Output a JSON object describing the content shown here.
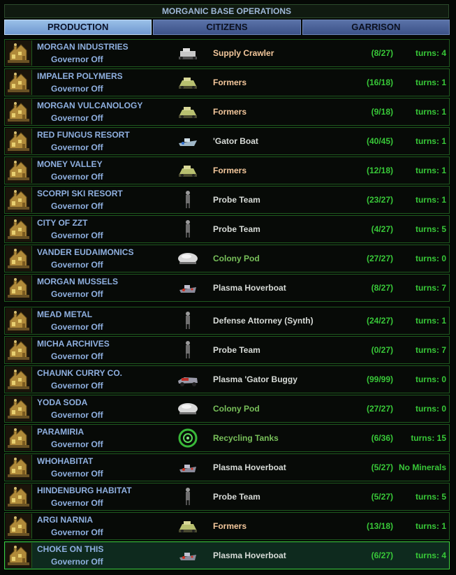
{
  "window_title": "MORGANIC BASE OPERATIONS",
  "tabs": [
    {
      "label": "PRODUCTION",
      "active": true
    },
    {
      "label": "CITIZENS",
      "active": false
    },
    {
      "label": "GARRISON",
      "active": false
    }
  ],
  "colors": {
    "facility": "#f4c89c",
    "unit": "#d8dcd8",
    "special": "#78c05a",
    "progress": "#38c838",
    "base_name": "#8fb0e0",
    "selected_border": "#3ed03e"
  },
  "bases": [
    {
      "name": "MORGAN INDUSTRIES",
      "governor": "Governor Off",
      "icon": "supply-crawler-icon",
      "item": "Supply Crawler",
      "item_color": "peach",
      "progress": "(8/27)",
      "turns": "turns: 4",
      "selected": false
    },
    {
      "name": "IMPALER POLYMERS",
      "governor": "Governor Off",
      "icon": "formers-icon",
      "item": "Formers",
      "item_color": "peach",
      "progress": "(16/18)",
      "turns": "turns: 1",
      "selected": false
    },
    {
      "name": "MORGAN VULCANOLOGY",
      "governor": "Governor Off",
      "icon": "formers-icon",
      "item": "Formers",
      "item_color": "peach",
      "progress": "(9/18)",
      "turns": "turns: 1",
      "selected": false
    },
    {
      "name": "RED FUNGUS RESORT",
      "governor": "Governor Off",
      "icon": "gator-boat-icon",
      "item": "'Gator Boat",
      "item_color": "white",
      "progress": "(40/45)",
      "turns": "turns: 1",
      "selected": false
    },
    {
      "name": "MONEY VALLEY",
      "governor": "Governor Off",
      "icon": "formers-icon",
      "item": "Formers",
      "item_color": "peach",
      "progress": "(12/18)",
      "turns": "turns: 1",
      "selected": false
    },
    {
      "name": "SCORPI SKI RESORT",
      "governor": "Governor Off",
      "icon": "probe-team-icon",
      "item": "Probe Team",
      "item_color": "white",
      "progress": "(23/27)",
      "turns": "turns: 1",
      "selected": false
    },
    {
      "name": "CITY OF ZZT",
      "governor": "Governor Off",
      "icon": "probe-team-icon",
      "item": "Probe Team",
      "item_color": "white",
      "progress": "(4/27)",
      "turns": "turns: 5",
      "selected": false
    },
    {
      "name": "VANDER EUDAIMONICS",
      "governor": "Governor Off",
      "icon": "colony-pod-icon",
      "item": "Colony Pod",
      "item_color": "green",
      "progress": "(27/27)",
      "turns": "turns: 0",
      "selected": false
    },
    {
      "name": "MORGAN MUSSELS",
      "governor": "Governor Off",
      "icon": "hoverboat-icon",
      "item": "Plasma Hoverboat",
      "item_color": "white",
      "progress": "(8/27)",
      "turns": "turns: 7",
      "selected": false
    },
    {
      "name": "MEAD METAL",
      "governor": "Governor Off",
      "icon": "probe-team-icon",
      "item": "Defense Attorney (Synth)",
      "item_color": "white",
      "progress": "(24/27)",
      "turns": "turns: 1",
      "selected": false
    },
    {
      "name": "MICHA ARCHIVES",
      "governor": "Governor Off",
      "icon": "probe-team-icon",
      "item": "Probe Team",
      "item_color": "white",
      "progress": "(0/27)",
      "turns": "turns: 7",
      "selected": false
    },
    {
      "name": "CHAUNK CURRY CO.",
      "governor": "Governor Off",
      "icon": "gator-buggy-icon",
      "item": "Plasma 'Gator Buggy",
      "item_color": "white",
      "progress": "(99/99)",
      "turns": "turns: 0",
      "selected": false
    },
    {
      "name": "YODA SODA",
      "governor": "Governor Off",
      "icon": "colony-pod-icon",
      "item": "Colony Pod",
      "item_color": "green",
      "progress": "(27/27)",
      "turns": "turns: 0",
      "selected": false
    },
    {
      "name": "PARAMIRIA",
      "governor": "Governor Off",
      "icon": "recycling-tanks-icon",
      "item": "Recycling Tanks",
      "item_color": "green",
      "progress": "(6/36)",
      "turns": "turns: 15",
      "selected": false
    },
    {
      "name": "WHOHABITAT",
      "governor": "Governor Off",
      "icon": "hoverboat-icon",
      "item": "Plasma Hoverboat",
      "item_color": "white",
      "progress": "(5/27)",
      "turns": "No Minerals",
      "selected": false
    },
    {
      "name": "HINDENBURG HABITAT",
      "governor": "Governor Off",
      "icon": "probe-team-icon",
      "item": "Probe Team",
      "item_color": "white",
      "progress": "(5/27)",
      "turns": "turns: 5",
      "selected": false
    },
    {
      "name": "ARGI NARNIA",
      "governor": "Governor Off",
      "icon": "formers-icon",
      "item": "Formers",
      "item_color": "peach",
      "progress": "(13/18)",
      "turns": "turns: 1",
      "selected": false
    },
    {
      "name": "CHOKE ON THIS",
      "governor": "Governor Off",
      "icon": "hoverboat-icon",
      "item": "Plasma Hoverboat",
      "item_color": "white",
      "progress": "(6/27)",
      "turns": "turns: 4",
      "selected": true
    }
  ]
}
